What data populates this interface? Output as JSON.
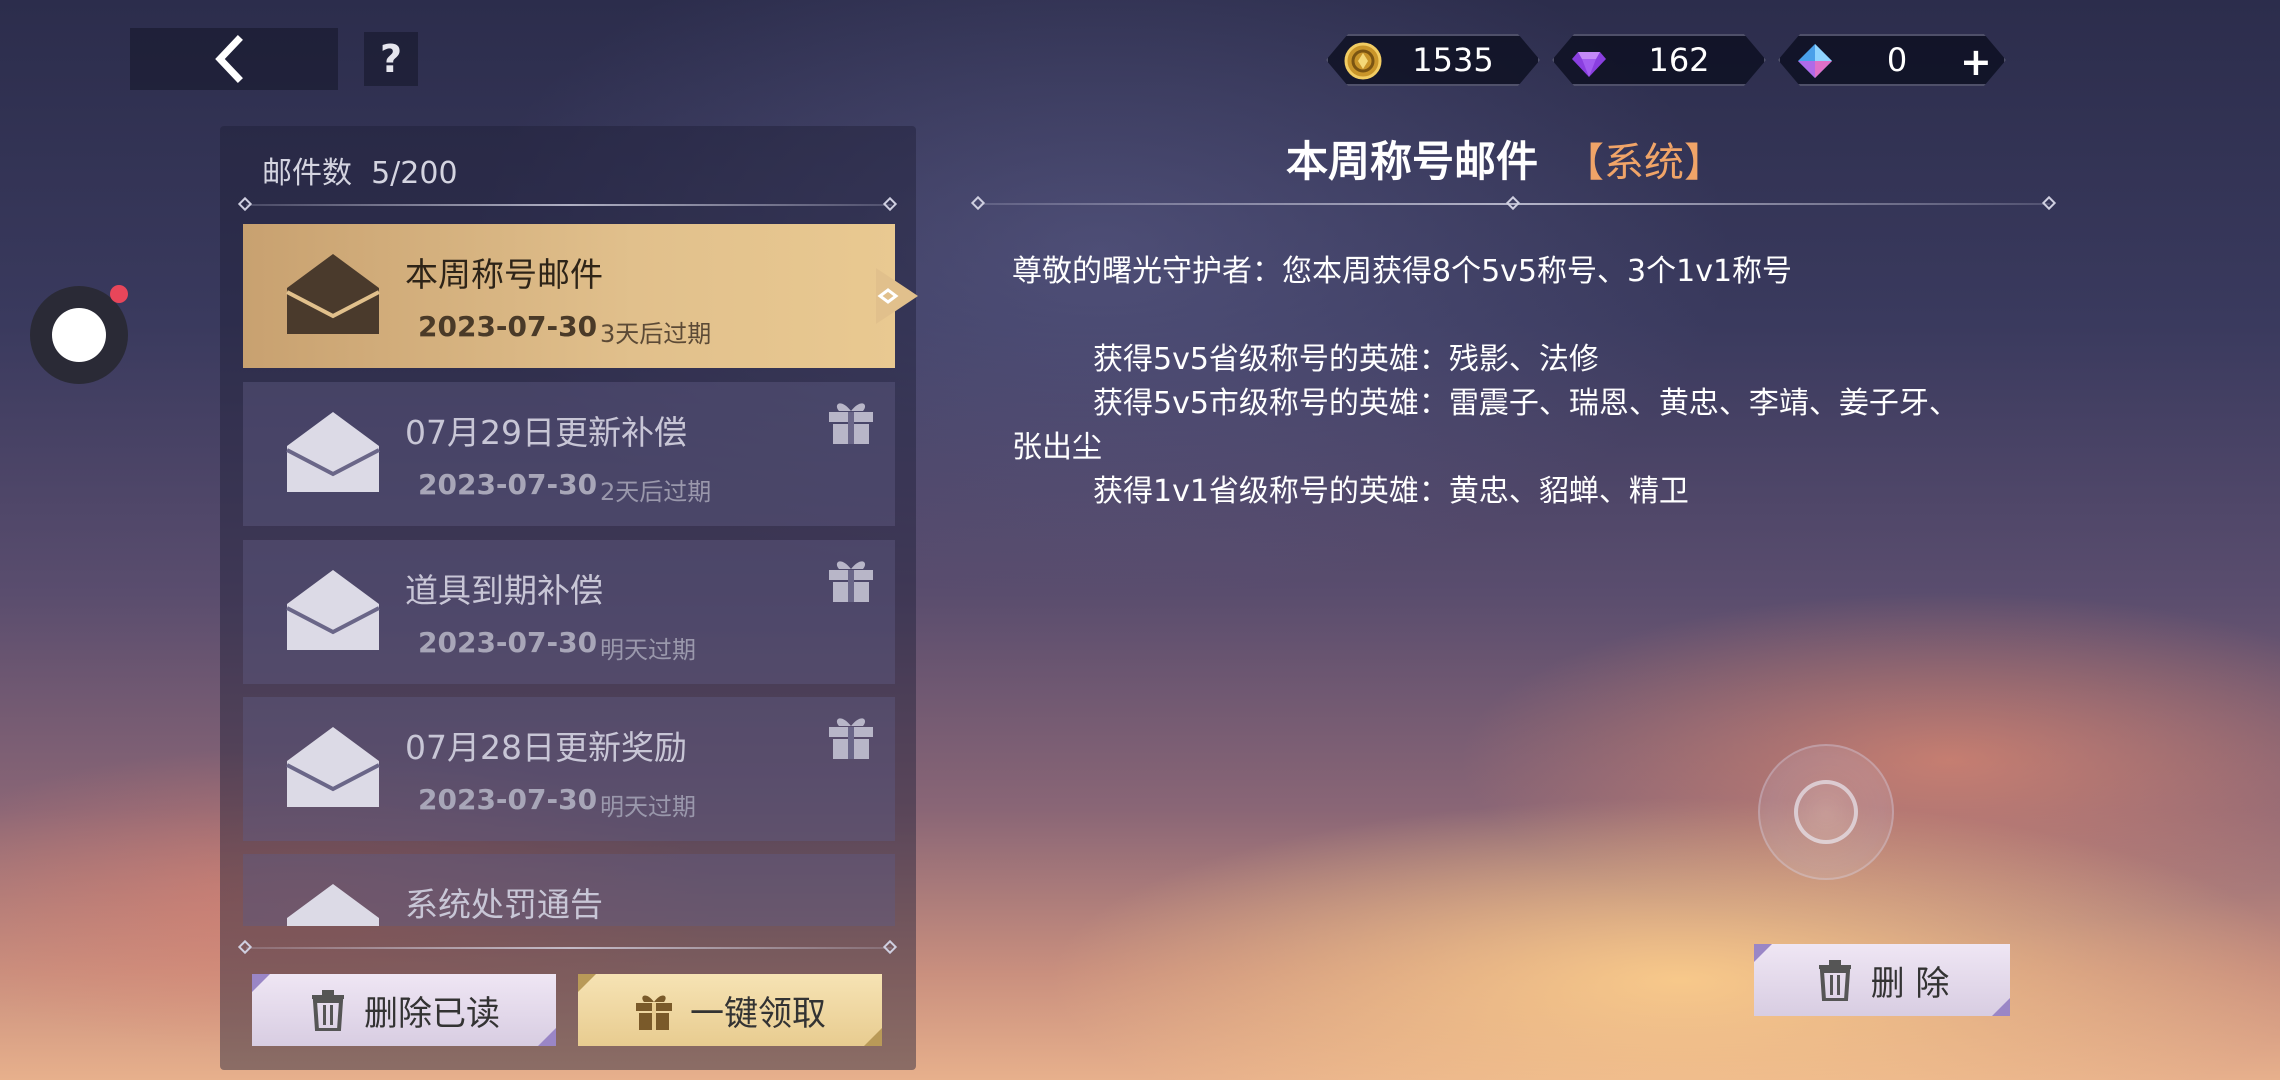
{
  "topbar": {
    "back_icon": "chevron-left-icon",
    "help_label": "?"
  },
  "currency": {
    "gold": {
      "value": "1535",
      "icon": "gold-coin-icon",
      "color": "#d6a634"
    },
    "gem": {
      "value": "162",
      "icon": "purple-gem-icon",
      "color": "#a25cf0"
    },
    "crystal": {
      "value": "0",
      "icon": "blue-crystal-icon",
      "color": "#5ab4f0"
    },
    "add_label": "+"
  },
  "mailbox": {
    "count_label": "邮件数",
    "count_value": "5/200",
    "items": [
      {
        "title": "本周称号邮件",
        "date": "2023-07-30",
        "expiry": "3天后过期",
        "active": true,
        "has_gift": false
      },
      {
        "title": "07月29日更新补偿",
        "date": "2023-07-30",
        "expiry": "2天后过期",
        "active": false,
        "has_gift": true
      },
      {
        "title": "道具到期补偿",
        "date": "2023-07-30",
        "expiry": "明天过期",
        "active": false,
        "has_gift": true
      },
      {
        "title": "07月28日更新奖励",
        "date": "2023-07-30",
        "expiry": "明天过期",
        "active": false,
        "has_gift": true
      },
      {
        "title": "系统处罚通告",
        "date": "",
        "expiry": "",
        "active": false,
        "has_gift": false
      }
    ],
    "delete_read_label": "删除已读",
    "claim_all_label": "一键领取"
  },
  "detail": {
    "title": "本周称号邮件",
    "tag": "【系统】",
    "greeting": "尊敬的曙光守护者：您本周获得8个5v5称号、3个1v1称号",
    "line1": "获得5v5省级称号的英雄：残影、法修",
    "line2a": "获得5v5市级称号的英雄：雷震子、瑞恩、黄忠、李靖、姜子牙、",
    "line2b": "张出尘",
    "line3": "获得1v1省级称号的英雄：黄忠、貂蝉、精卫",
    "delete_label": "删 除"
  },
  "colors": {
    "active_item": "#e1c08c",
    "tag_orange": "#f0a468",
    "notification_dot": "#e8465a"
  }
}
